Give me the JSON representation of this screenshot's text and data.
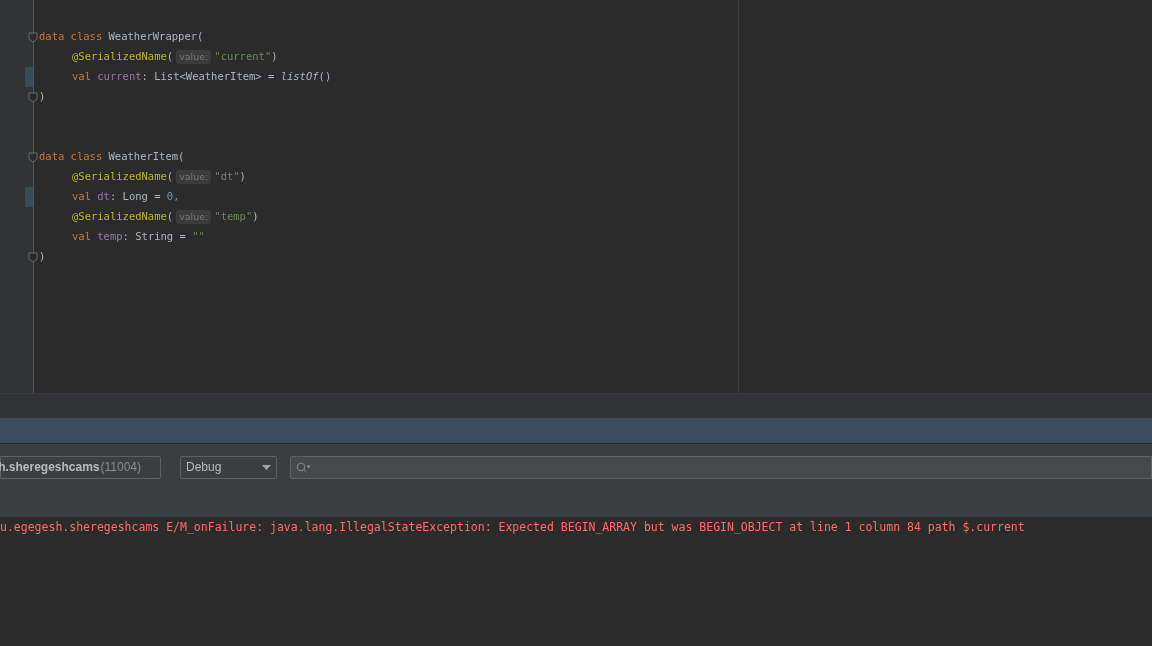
{
  "editor": {
    "declarations": [
      {
        "open": [
          {
            "kind": "keyword",
            "text": "data class "
          },
          {
            "kind": "plain",
            "text": "WeatherWrapper("
          }
        ],
        "members": [
          {
            "changed": false,
            "tokens": [
              {
                "kind": "annotation",
                "text": "@SerializedName"
              },
              {
                "kind": "plain",
                "text": "("
              },
              {
                "kind": "hint",
                "text": "value:"
              },
              {
                "kind": "string",
                "text": "\"current\""
              },
              {
                "kind": "plain",
                "text": ")"
              }
            ]
          },
          {
            "changed": true,
            "tokens": [
              {
                "kind": "keyword",
                "text": "val "
              },
              {
                "kind": "property",
                "text": "current"
              },
              {
                "kind": "plain",
                "text": ": List<WeatherItem> = "
              },
              {
                "kind": "function",
                "text": "listOf"
              },
              {
                "kind": "plain",
                "text": "()"
              }
            ]
          }
        ],
        "close": [
          {
            "kind": "plain",
            "text": ")"
          }
        ]
      },
      {
        "open": [
          {
            "kind": "keyword",
            "text": "data class "
          },
          {
            "kind": "plain",
            "text": "WeatherItem("
          }
        ],
        "members": [
          {
            "changed": false,
            "tokens": [
              {
                "kind": "annotation",
                "text": "@SerializedName"
              },
              {
                "kind": "plain",
                "text": "("
              },
              {
                "kind": "hint",
                "text": "value:"
              },
              {
                "kind": "string",
                "text": "\"dt\""
              },
              {
                "kind": "plain",
                "text": ")"
              }
            ]
          },
          {
            "changed": true,
            "tokens": [
              {
                "kind": "keyword",
                "text": "val "
              },
              {
                "kind": "property",
                "text": "dt"
              },
              {
                "kind": "plain",
                "text": ": Long = "
              },
              {
                "kind": "number",
                "text": "0"
              },
              {
                "kind": "keyword",
                "text": ","
              }
            ]
          },
          {
            "changed": false,
            "tokens": [
              {
                "kind": "annotation",
                "text": "@SerializedName"
              },
              {
                "kind": "plain",
                "text": "("
              },
              {
                "kind": "hint",
                "text": "value:"
              },
              {
                "kind": "string",
                "text": "\"temp\""
              },
              {
                "kind": "plain",
                "text": ")"
              }
            ]
          },
          {
            "changed": false,
            "tokens": [
              {
                "kind": "keyword",
                "text": "val "
              },
              {
                "kind": "property",
                "text": "temp"
              },
              {
                "kind": "plain",
                "text": ": String = "
              },
              {
                "kind": "string",
                "text": "\"\""
              }
            ]
          }
        ],
        "close": [
          {
            "kind": "plain",
            "text": ")"
          }
        ]
      }
    ]
  },
  "logcat": {
    "process": {
      "name": "h.sheregeshcams",
      "pid": "(11004)"
    },
    "level": "Debug",
    "log_lines": [
      "u.egegesh.sheregeshcams E/M_onFailure: java.lang.IllegalStateException: Expected BEGIN_ARRAY but was BEGIN_OBJECT at line 1 column 84 path $.current"
    ]
  }
}
